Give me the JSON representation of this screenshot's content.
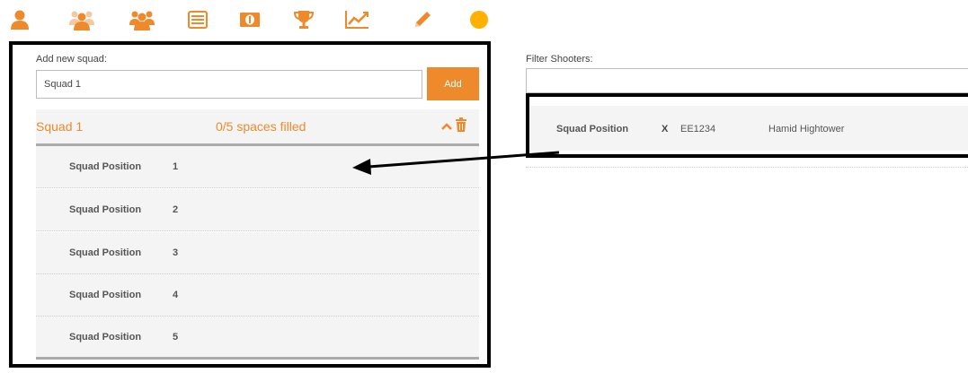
{
  "toolbar": {
    "accent": "#ee8a2c",
    "icons": [
      "user-icon",
      "group-icon",
      "group-alt-icon",
      "list-icon",
      "money-icon",
      "trophy-icon",
      "chart-icon",
      "pencil-icon",
      "circle-icon"
    ]
  },
  "squad_form": {
    "label": "Add new squad:",
    "input_value": "Squad 1",
    "add_label": "Add"
  },
  "squad": {
    "name": "Squad 1",
    "filled": "0/5 spaces filled",
    "positions": [
      {
        "label": "Squad Position",
        "number": "1"
      },
      {
        "label": "Squad Position",
        "number": "2"
      },
      {
        "label": "Squad Position",
        "number": "3"
      },
      {
        "label": "Squad Position",
        "number": "4"
      },
      {
        "label": "Squad Position",
        "number": "5"
      }
    ]
  },
  "filter": {
    "label": "Filter Shooters:",
    "input_value": ""
  },
  "shooter": {
    "label": "Squad Position",
    "remove": "X",
    "id": "EE1234",
    "name": "Hamid Hightower"
  }
}
